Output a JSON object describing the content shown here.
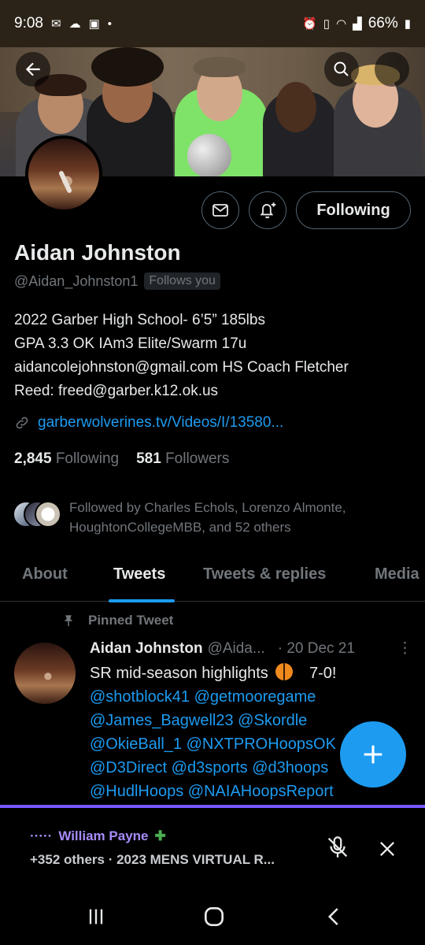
{
  "status_bar": {
    "time": "9:08",
    "battery": "66%"
  },
  "profile": {
    "name": "Aidan Johnston",
    "handle": "@Aidan_Johnston1",
    "follows_you": "Follows you",
    "bio": [
      "2022 Garber High School- 6’5” 185lbs",
      "GPA 3.3 OK IAm3 Elite/Swarm 17u",
      "aidancolejohnston@gmail.com HS Coach Fletcher",
      "Reed: freed@garber.k12.ok.us"
    ],
    "link": "garberwolverines.tv/Videos/I/13580...",
    "following_count": "2,845",
    "following_label": "Following",
    "followers_count": "581",
    "followers_label": "Followers",
    "followed_by": "Followed by Charles Echols, Lorenzo Almonte, HoughtonCollegeMBB, and 52 others",
    "following_button": "Following"
  },
  "tabs": [
    "About",
    "Tweets",
    "Tweets & replies",
    "Media"
  ],
  "pinned_tweet": {
    "pinned_label": "Pinned Tweet",
    "author": "Aidan Johnston",
    "handle": "@Aida...",
    "date": "· 20 Dec 21",
    "text_start": "SR mid-season highlights",
    "text_end": "7-0!",
    "mentions": [
      "@shotblock41 @getmooregame",
      "@James_Bagwell23 @Skordle",
      "@OkieBall_1 @NXTPROHoopsOK",
      "@D3Direct @d3sports @d3hoops",
      "@HudlHoops @NAIAHoopsReport"
    ]
  },
  "space": {
    "host": "William Payne",
    "dots": "·····",
    "subtitle": "+352 others · 2023 MENS VIRTUAL R..."
  },
  "colors": {
    "accent": "#1d9bf0",
    "space_accent": "#7856ff",
    "background": "#000000",
    "text_secondary": "#71767b"
  },
  "icons": [
    "back-arrow-icon",
    "search-icon",
    "more-icon",
    "mail-icon",
    "bell-plus-icon",
    "link-icon",
    "pin-icon",
    "compose-plus-icon",
    "mic-off-icon",
    "close-icon",
    "recents-icon",
    "home-icon",
    "back-nav-icon"
  ]
}
